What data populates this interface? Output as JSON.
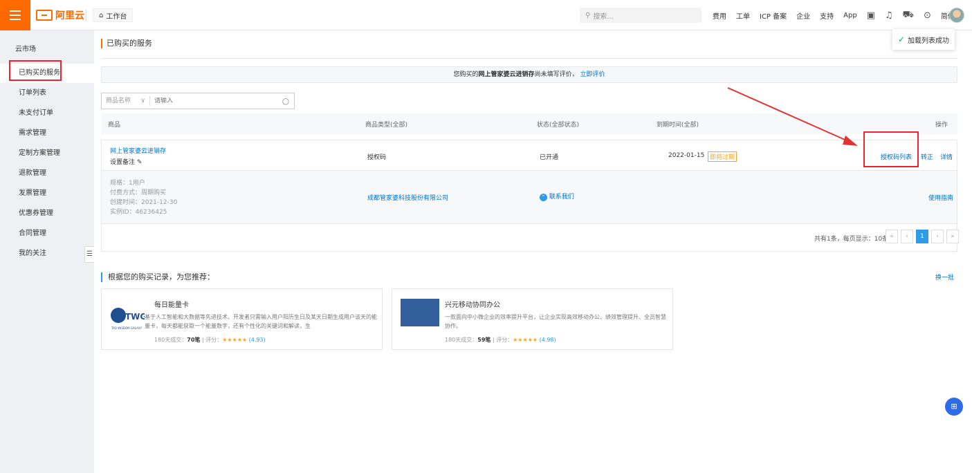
{
  "topbar": {
    "brand": "阿里云",
    "workbench": "工作台",
    "search_placeholder": "搜索...",
    "nav": [
      "费用",
      "工单",
      "ICP 备案",
      "企业",
      "支持",
      "App"
    ],
    "lang": "简体",
    "icons": [
      "terminal-icon",
      "bell-icon",
      "cart-icon",
      "help-icon"
    ]
  },
  "toast": {
    "text": "加载列表成功"
  },
  "sidebar": {
    "title": "云市场",
    "items": [
      {
        "label": "已购买的服务"
      },
      {
        "label": "订单列表"
      },
      {
        "label": "未支付订单"
      },
      {
        "label": "需求管理"
      },
      {
        "label": "定制方案管理"
      },
      {
        "label": "退款管理"
      },
      {
        "label": "发票管理"
      },
      {
        "label": "优惠券管理"
      },
      {
        "label": "合同管理"
      },
      {
        "label": "我的关注"
      }
    ],
    "collapse_glyph": "☰"
  },
  "page": {
    "title": "已购买的服务",
    "notice_prefix": "您购买的",
    "notice_product": "网上管家婆云进销存",
    "notice_suffix": "尚未填写评价，",
    "notice_link": "立即评价"
  },
  "filter": {
    "select_label": "商品名称",
    "input_placeholder": "请输入"
  },
  "table": {
    "headers": {
      "product": "商品",
      "type": "商品类型(全部)",
      "status": "状态(全部状态)",
      "expire": "到期时间(全部)",
      "ops": "操作"
    },
    "rows": [
      {
        "name": "网上管家婆云进销存",
        "note_label": "设置备注",
        "type": "授权码",
        "status": "已开通",
        "expire_date": "2022-01-15",
        "expire_badge": "即将过期",
        "actions": [
          "授权码列表",
          "转正",
          "详情"
        ],
        "spec": "规格：1用户",
        "pay": "付费方式：周期购买",
        "created": "创建时间：2021-12-30",
        "instance": "实例ID：46236425",
        "vendor": "成都管家婆科技股份有限公司",
        "contact": "联系我们",
        "guide": "使用指南"
      }
    ]
  },
  "pager": {
    "summary": "共有1条，每页显示：10条",
    "buttons": [
      "«",
      "‹",
      "1",
      "›",
      "»"
    ],
    "current": "1"
  },
  "recommend": {
    "title": "根据您的购买记录，为您推荐：",
    "more": "换一批",
    "cards": [
      {
        "title": "每日能量卡",
        "desc": "基于人工智能和大数据等先进技术、开发者只需输入用户阳历生日及某天日期生成用户该天的能量卡，每天都能获取一个能量数字，还有个性化的关键词和解读，生",
        "deals_label": "180天成交：",
        "deals": "70笔",
        "score_label": "评分：",
        "stars": "★★★★★",
        "score": "(4.93)",
        "logo_text": "TWG",
        "logo_sub": "TAO WISDOM GALAXY"
      },
      {
        "title": "兴元移动协同办公",
        "desc": "一款面向中小微企业的效率提升平台，让企业实现高效移动办公、绩效管理提升、全员智慧协作。",
        "deals_label": "180天成交：",
        "deals": "59笔",
        "score_label": "评分：",
        "stars": "★★★★★",
        "score": "(4.98)"
      }
    ]
  },
  "colors": {
    "brand": "#ff6a00",
    "link": "#0070cc",
    "highlight": "#e23333",
    "primary": "#2d9be5"
  }
}
